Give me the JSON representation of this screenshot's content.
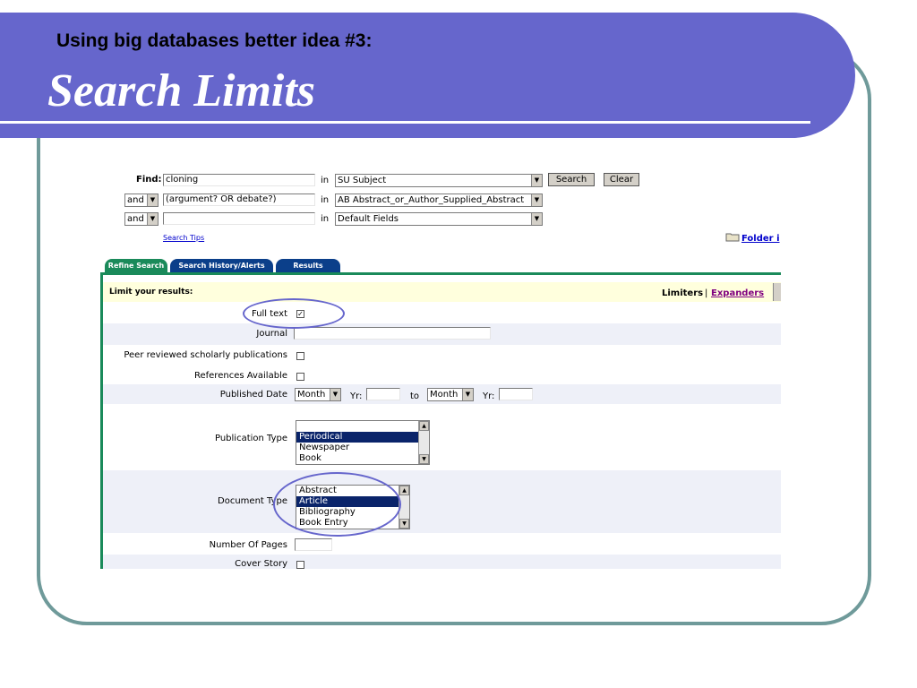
{
  "slide": {
    "subtitle": "Using big databases better idea #3:",
    "title": "Search Limits"
  },
  "search": {
    "find_label": "Find:",
    "rows": [
      {
        "operator": "",
        "term": "cloning",
        "in_label": "in",
        "field": "SU Subject"
      },
      {
        "operator": "and",
        "term": "(argument? OR debate?)",
        "in_label": "in",
        "field": "AB Abstract_or_Author_Supplied_Abstract"
      },
      {
        "operator": "and",
        "term": "",
        "in_label": "in",
        "field": "Default Fields"
      }
    ],
    "search_button": "Search",
    "clear_button": "Clear",
    "tips_link": "Search Tips",
    "folder_link": "Folder i"
  },
  "tabs": [
    "Refine Search",
    "Search History/Alerts",
    "Results"
  ],
  "limits": {
    "header": "Limit your results:",
    "limiters_label": "Limiters",
    "separator": "|",
    "expanders_link": "Expanders",
    "full_text": {
      "label": "Full text",
      "checked": true
    },
    "journal": {
      "label": "Journal",
      "value": ""
    },
    "peer_reviewed": {
      "label": "Peer reviewed scholarly publications",
      "checked": false
    },
    "references": {
      "label": "References Available",
      "checked": false
    },
    "published_date": {
      "label": "Published Date",
      "month1": "Month",
      "yr1_label": "Yr:",
      "to_label": "to",
      "month2": "Month",
      "yr2_label": "Yr:"
    },
    "publication_type": {
      "label": "Publication Type",
      "options": [
        "",
        "Periodical",
        "Newspaper",
        "Book"
      ],
      "selected": "Periodical"
    },
    "document_type": {
      "label": "Document Type",
      "options": [
        "Abstract",
        "Article",
        "Bibliography",
        "Book Entry"
      ],
      "selected": "Article"
    },
    "pages": {
      "label": "Number Of Pages",
      "value": ""
    },
    "cover_story": {
      "label": "Cover Story",
      "checked": false
    }
  },
  "colors": {
    "header_band": "#6666cc",
    "frame": "#6f9a9a",
    "tab_active": "#1a8a5a",
    "tab_inactive": "#0b3f8a",
    "limit_header_bg": "#ffffdd",
    "row_shade": "#eef0f8",
    "link": "#0000cc",
    "expanders": "#800080",
    "highlight_ellipse": "#6666cc"
  }
}
